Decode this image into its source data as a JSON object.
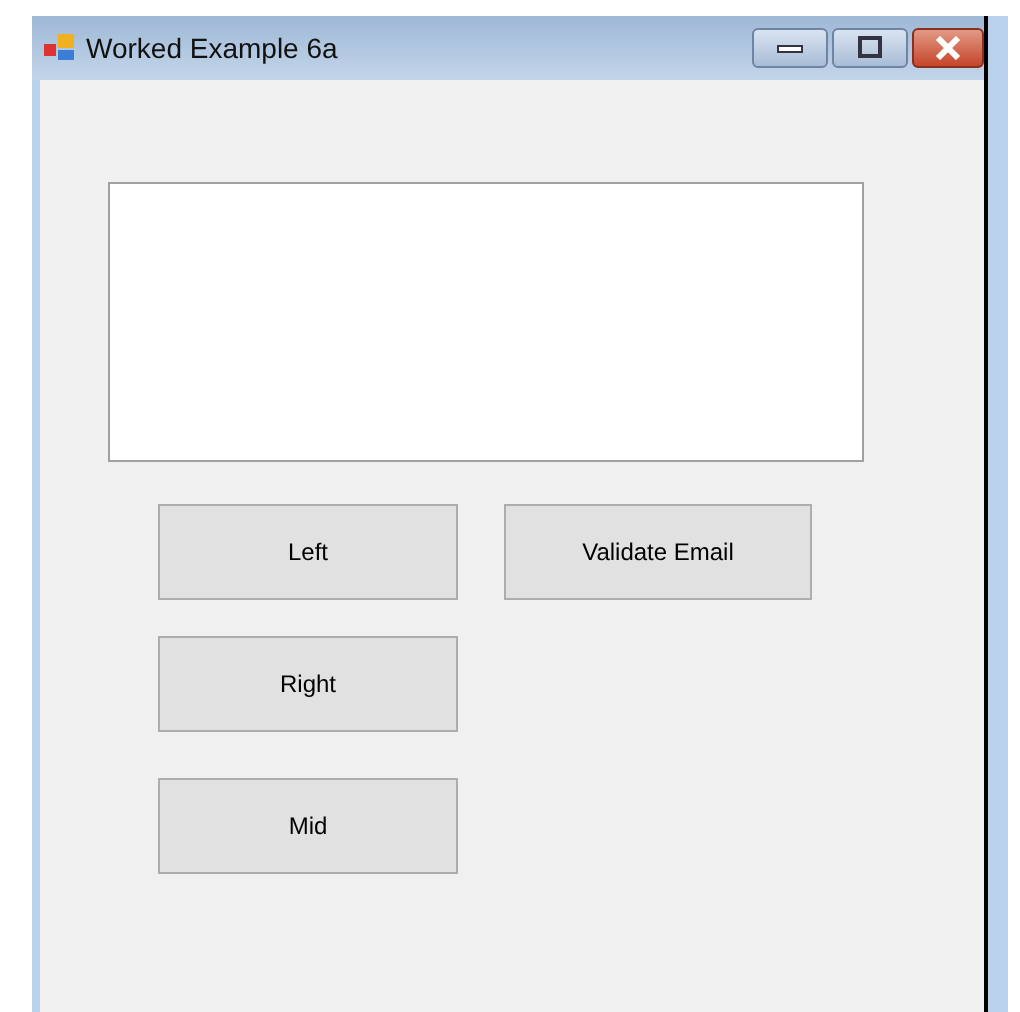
{
  "window": {
    "title": "Worked Example 6a"
  },
  "buttons": [
    {
      "label": "Left"
    },
    {
      "label": "Validate Email"
    },
    {
      "label": "Right"
    },
    {
      "label": "Mid"
    }
  ]
}
